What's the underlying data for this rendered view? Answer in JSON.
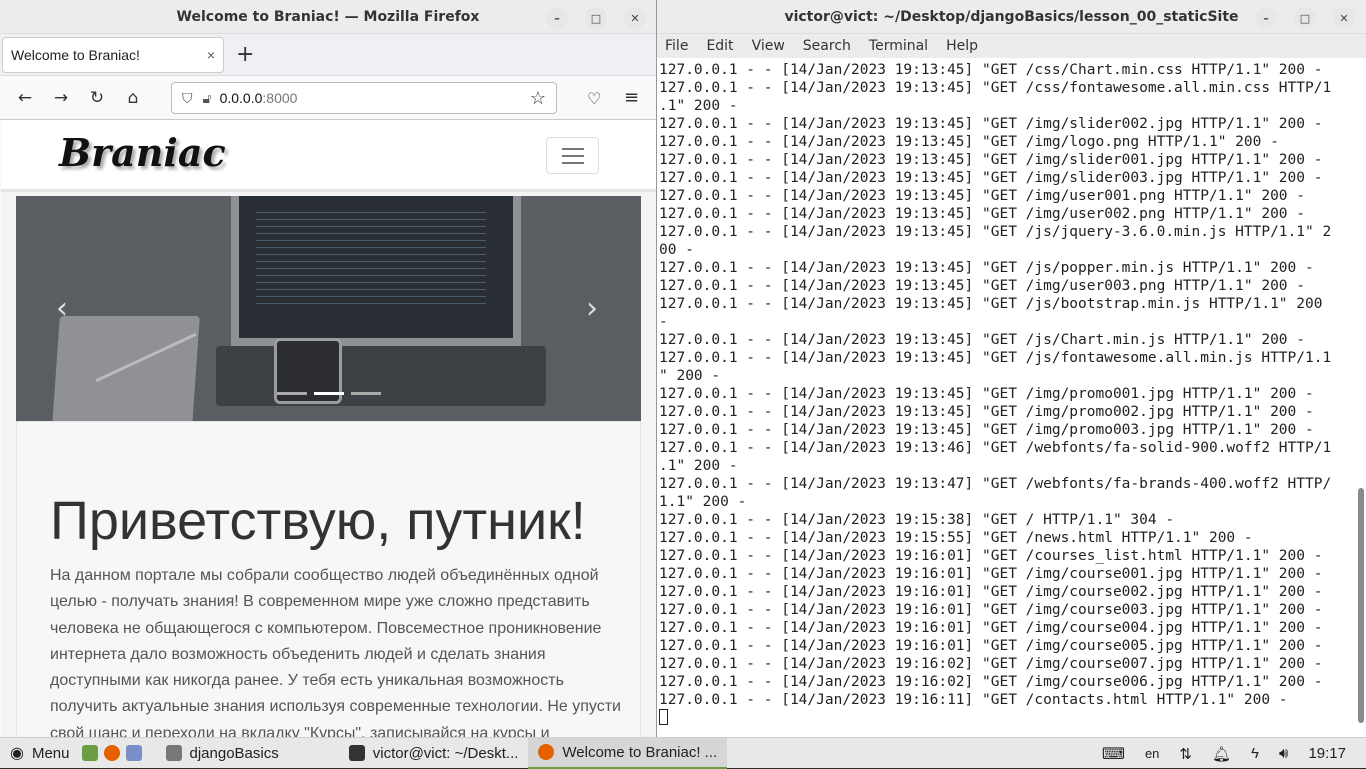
{
  "firefox": {
    "window_title": "Welcome to Braniac! — Mozilla Firefox",
    "tab_title": "Welcome to Braniac!",
    "new_tab": "+",
    "tab_close": "×",
    "url_host": "0.0.0.0",
    "url_port": ":8000",
    "site": {
      "logo": "Braniac",
      "heading": "Приветствую, путник!",
      "paragraph": "На данном портале мы собрали сообщество людей объединённых одной целью - получать знания! В современном мире уже сложно представить человека не общающегося с компьютером. Повсеместное проникновение интернета дало возможность объеденить людей и сделать знания доступными как никогда ранее. У тебя есть уникальная возможность получить актуальные знания используя современные технологии. Не упусти свой шанс и переходи на вкладку \"Курсы\", записывайся на курсы и",
      "carousel_prev": "‹",
      "carousel_next": "›"
    }
  },
  "terminal": {
    "window_title": "victor@vict: ~/Desktop/djangoBasics/lesson_00_staticSite",
    "menu": [
      "File",
      "Edit",
      "View",
      "Search",
      "Terminal",
      "Help"
    ],
    "lines": [
      "127.0.0.1 - - [14/Jan/2023 19:13:45] \"GET /css/Chart.min.css HTTP/1.1\" 200 -",
      "127.0.0.1 - - [14/Jan/2023 19:13:45] \"GET /css/fontawesome.all.min.css HTTP/1",
      ".1\" 200 -",
      "127.0.0.1 - - [14/Jan/2023 19:13:45] \"GET /img/slider002.jpg HTTP/1.1\" 200 -",
      "127.0.0.1 - - [14/Jan/2023 19:13:45] \"GET /img/logo.png HTTP/1.1\" 200 -",
      "127.0.0.1 - - [14/Jan/2023 19:13:45] \"GET /img/slider001.jpg HTTP/1.1\" 200 -",
      "127.0.0.1 - - [14/Jan/2023 19:13:45] \"GET /img/slider003.jpg HTTP/1.1\" 200 -",
      "127.0.0.1 - - [14/Jan/2023 19:13:45] \"GET /img/user001.png HTTP/1.1\" 200 -",
      "127.0.0.1 - - [14/Jan/2023 19:13:45] \"GET /img/user002.png HTTP/1.1\" 200 -",
      "127.0.0.1 - - [14/Jan/2023 19:13:45] \"GET /js/jquery-3.6.0.min.js HTTP/1.1\" 2",
      "00 -",
      "127.0.0.1 - - [14/Jan/2023 19:13:45] \"GET /js/popper.min.js HTTP/1.1\" 200 -",
      "127.0.0.1 - - [14/Jan/2023 19:13:45] \"GET /img/user003.png HTTP/1.1\" 200 -",
      "127.0.0.1 - - [14/Jan/2023 19:13:45] \"GET /js/bootstrap.min.js HTTP/1.1\" 200",
      "-",
      "127.0.0.1 - - [14/Jan/2023 19:13:45] \"GET /js/Chart.min.js HTTP/1.1\" 200 -",
      "127.0.0.1 - - [14/Jan/2023 19:13:45] \"GET /js/fontawesome.all.min.js HTTP/1.1",
      "\" 200 -",
      "127.0.0.1 - - [14/Jan/2023 19:13:45] \"GET /img/promo001.jpg HTTP/1.1\" 200 -",
      "127.0.0.1 - - [14/Jan/2023 19:13:45] \"GET /img/promo002.jpg HTTP/1.1\" 200 -",
      "127.0.0.1 - - [14/Jan/2023 19:13:45] \"GET /img/promo003.jpg HTTP/1.1\" 200 -",
      "127.0.0.1 - - [14/Jan/2023 19:13:46] \"GET /webfonts/fa-solid-900.woff2 HTTP/1",
      ".1\" 200 -",
      "127.0.0.1 - - [14/Jan/2023 19:13:47] \"GET /webfonts/fa-brands-400.woff2 HTTP/",
      "1.1\" 200 -",
      "127.0.0.1 - - [14/Jan/2023 19:15:38] \"GET / HTTP/1.1\" 304 -",
      "127.0.0.1 - - [14/Jan/2023 19:15:55] \"GET /news.html HTTP/1.1\" 200 -",
      "127.0.0.1 - - [14/Jan/2023 19:16:01] \"GET /courses_list.html HTTP/1.1\" 200 -",
      "127.0.0.1 - - [14/Jan/2023 19:16:01] \"GET /img/course001.jpg HTTP/1.1\" 200 -",
      "127.0.0.1 - - [14/Jan/2023 19:16:01] \"GET /img/course002.jpg HTTP/1.1\" 200 -",
      "127.0.0.1 - - [14/Jan/2023 19:16:01] \"GET /img/course003.jpg HTTP/1.1\" 200 -",
      "127.0.0.1 - - [14/Jan/2023 19:16:01] \"GET /img/course004.jpg HTTP/1.1\" 200 -",
      "127.0.0.1 - - [14/Jan/2023 19:16:01] \"GET /img/course005.jpg HTTP/1.1\" 200 -",
      "127.0.0.1 - - [14/Jan/2023 19:16:02] \"GET /img/course007.jpg HTTP/1.1\" 200 -",
      "127.0.0.1 - - [14/Jan/2023 19:16:02] \"GET /img/course006.jpg HTTP/1.1\" 200 -",
      "127.0.0.1 - - [14/Jan/2023 19:16:11] \"GET /contacts.html HTTP/1.1\" 200 -"
    ]
  },
  "taskbar": {
    "menu_label": "Menu",
    "items": [
      {
        "label": "djangoBasics",
        "icon": "folder-icon"
      },
      {
        "label": "victor@vict: ~/Deskt...",
        "icon": "terminal-icon"
      },
      {
        "label": "Welcome to Braniac! ...",
        "icon": "firefox-icon"
      }
    ],
    "lang": "en",
    "clock": "19:17"
  }
}
